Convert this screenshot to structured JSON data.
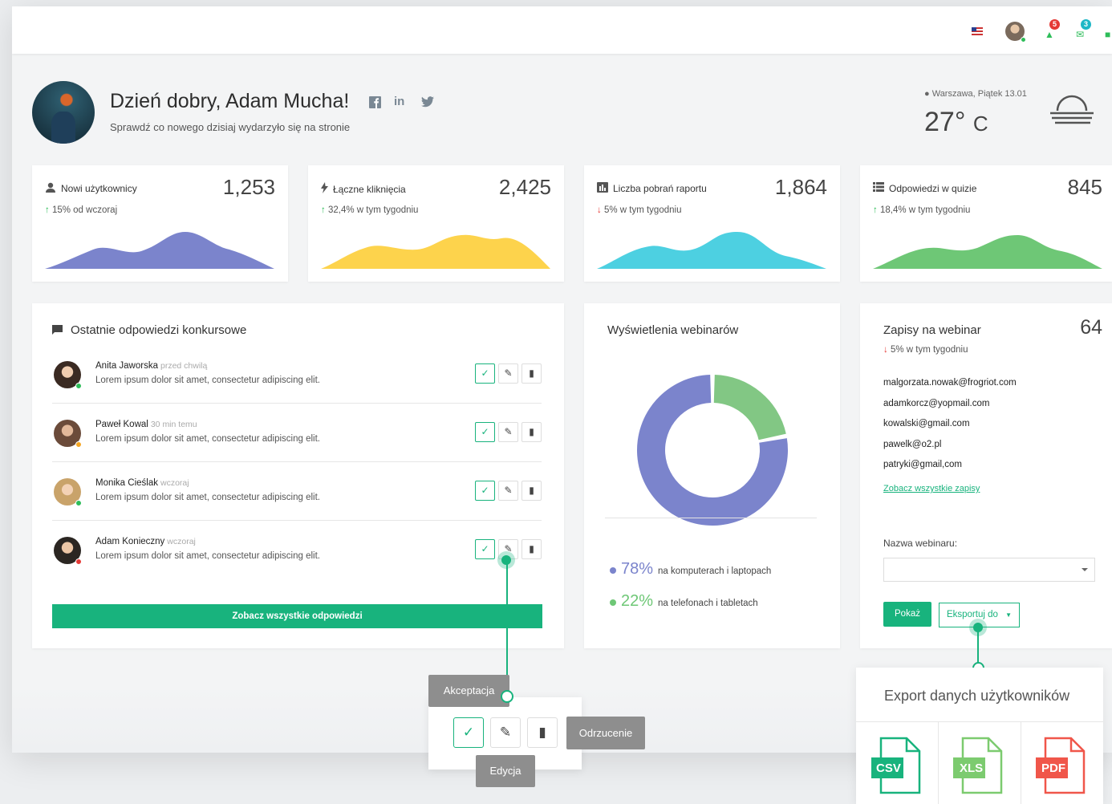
{
  "header": {
    "badges": {
      "notifications": "5",
      "messages": "3"
    }
  },
  "profile": {
    "greeting": "Dzień dobry, Adam Mucha!",
    "subtitle": "Sprawdź co nowego dzisiaj wydarzyło się na stronie",
    "social": {
      "facebook": "f",
      "linkedin": "in",
      "twitter": "t"
    }
  },
  "weather": {
    "location": "Warszawa, Piątek 13.01",
    "temperature": "27°",
    "unit": "C",
    "icon": "fog-icon"
  },
  "stats": [
    {
      "icon": "user-icon",
      "title": "Nowi użytkownicy",
      "value": "1,253",
      "trend": "up",
      "delta": "15% od wczoraj",
      "color": "#7b84cc"
    },
    {
      "icon": "bolt-icon",
      "title": "Łączne kliknięcia",
      "value": "2,425",
      "trend": "up",
      "delta": "32,4% w tym tygodniu",
      "color": "#fdd34c"
    },
    {
      "icon": "bar-chart-icon",
      "title": "Liczba pobrań raportu",
      "value": "1,864",
      "trend": "down",
      "delta": "5% w tym tygodniu",
      "color": "#4dd0e1"
    },
    {
      "icon": "list-icon",
      "title": "Odpowiedzi w quizie",
      "value": "845",
      "trend": "up",
      "delta": "18,4% w tym tygodniu",
      "color": "#6ec776"
    }
  ],
  "responses": {
    "title": "Ostatnie odpowiedzi konkursowe",
    "items": [
      {
        "name": "Anita Jaworska",
        "time": "przed chwilą",
        "text": "Lorem ipsum dolor sit amet, consectetur adipiscing elit.",
        "status": "#2ebd59"
      },
      {
        "name": "Paweł Kowal",
        "time": "30 min temu",
        "text": "Lorem ipsum dolor sit amet, consectetur adipiscing elit.",
        "status": "#f5a623"
      },
      {
        "name": "Monika Cieślak",
        "time": "wczoraj",
        "text": "Lorem ipsum dolor sit amet, consectetur adipiscing elit.",
        "status": "#2ebd59"
      },
      {
        "name": "Adam Konieczny",
        "time": "wczoraj",
        "text": "Lorem ipsum dolor sit amet, consectetur adipiscing elit.",
        "status": "#e53935"
      }
    ],
    "button": "Zobacz wszystkie odpowiedzi"
  },
  "webinar_views": {
    "title": "Wyświetlenia webinarów",
    "chart_data": {
      "type": "pie",
      "values": [
        78,
        22
      ],
      "colors": [
        "#7b84cc",
        "#82c784"
      ]
    },
    "legend": [
      {
        "pct": "78%",
        "label": "na komputerach i laptopach",
        "color": "#7b84cc"
      },
      {
        "pct": "22%",
        "label": "na telefonach i tabletach",
        "color": "#6ec776"
      }
    ]
  },
  "signups": {
    "title": "Zapisy na webinar",
    "count": "64",
    "delta": "5% w tym tygodniu",
    "emails": [
      "malgorzata.nowak@frogriot.com",
      "adamkorcz@yopmail.com",
      "kowalski@gmail.com",
      "pawelk@o2.pl",
      "patryki@gmail,com"
    ],
    "link": "Zobacz wszystkie zapisy",
    "webinar_label": "Nazwa webinaru:",
    "webinar_value": "",
    "show_button": "Pokaż",
    "export_button": "Eksportuj do"
  },
  "callouts": {
    "accept": "Akceptacja",
    "edit": "Edycja",
    "reject": "Odrzucenie"
  },
  "export_panel": {
    "title": "Export danych użytkowników",
    "formats": [
      {
        "label": "CSV",
        "color": "#18b37d"
      },
      {
        "label": "XLS",
        "color": "#7ccb6f"
      },
      {
        "label": "PDF",
        "color": "#f0564a"
      }
    ]
  }
}
